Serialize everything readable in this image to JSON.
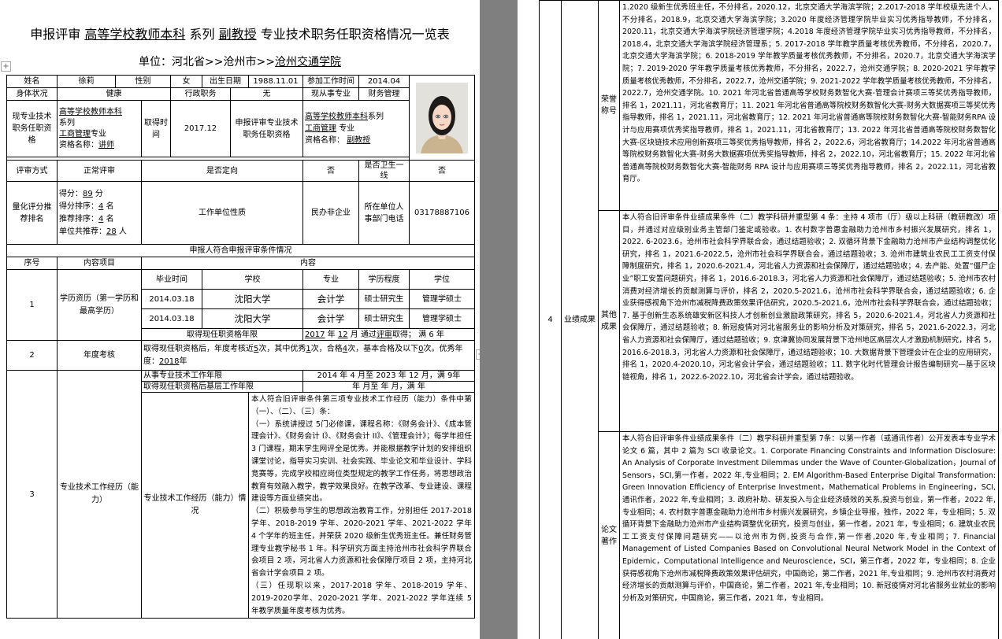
{
  "title": {
    "prefix": "申报评审",
    "school_type": "高等学校教师本科",
    "series_label": "系列",
    "rank": "副教授",
    "suffix": "专业技术职务任职资格情况一览表"
  },
  "unit": {
    "label": "单位：河北省>>沧州市>>",
    "name": "沧州交通学院"
  },
  "personal": {
    "name_label": "姓名",
    "name": "徐莉",
    "gender_label": "性别",
    "gender": "女",
    "birth_label": "出生日期",
    "birth": "1988.11.01",
    "work_start_label": "参加工作时间",
    "work_start": "2014.04",
    "health_label": "身体状况",
    "health": "健康",
    "admin_label": "行政职务",
    "admin": "无",
    "major_now_label": "现从事专业",
    "major_now": "财务管理"
  },
  "qualification": {
    "current_label": "现专业技术职务任职资格",
    "current_series": "高等学校教师本科",
    "series_word": "系列",
    "current_major": "工商管理",
    "major_word": "专业",
    "cert_label": "资格名称：",
    "current_name": "讲师",
    "obtain_label": "取得时间",
    "obtain_time": "2017.12",
    "apply_label": "申报评审专业技术职务任职资格",
    "apply_series": "高等学校教师本科",
    "apply_major": "工商管理",
    "apply_name": "副教授"
  },
  "review": {
    "method_label": "评审方式",
    "method": "正常评审",
    "directional_label": "是否定向",
    "directional": "否",
    "frontline_label": "是否卫生一线",
    "frontline": "否"
  },
  "score": {
    "label": "量化评分推荐排名",
    "score_prefix": "得分：",
    "score": "89",
    "score_unit": "分",
    "rank_prefix": "得分排序：",
    "rank": "4",
    "rank_unit": "名",
    "recommend_prefix": "推荐排序：",
    "recommend": "4",
    "recommend_unit": "名",
    "count_prefix": "单位共推荐：",
    "count": "28",
    "count_unit": "人",
    "unit_nature_label": "工作单位性质",
    "unit_nature": "民办非企业",
    "phone_label": "所在单位人事部门电话",
    "phone": "03178887106"
  },
  "conditions_heading": "申报人符合申报评审条件情况",
  "cond_headers": {
    "no": "序号",
    "item": "内容项目",
    "content": "内容"
  },
  "education": {
    "no": "1",
    "label": "学历资历（第一学历和最高学历）",
    "headers": [
      "毕业时间",
      "学校",
      "专业",
      "学历程度",
      "学位"
    ],
    "rows": [
      [
        "2014.03.18",
        "沈阳大学",
        "会计学",
        "硕士研究生",
        "管理学硕士"
      ],
      [
        "2014.03.18",
        "沈阳大学",
        "会计学",
        "硕士研究生",
        "管理学硕士"
      ]
    ],
    "years_label": "取得现任职资格年限",
    "years_year": "2017",
    "years_year_unit": "年",
    "years_month": "12",
    "years_month_unit": "月",
    "years_via": "通过",
    "years_method": "评审",
    "years_get": "取得；",
    "years_full_prefix": "满",
    "years_full": "6",
    "years_full_unit": "年"
  },
  "assessment": {
    "no": "2",
    "label": "年度考核",
    "p1": "取得现任职资格后，年度考核近",
    "n1": "5",
    "p2": "次，其中优秀",
    "n2": "1",
    "p3": "次，合格",
    "n3": "4",
    "p4": "次，基本合格及以下",
    "n4": "0",
    "p5": "次。优秀年度：",
    "excellent_year": "2018",
    "p6": "年"
  },
  "experience": {
    "no": "3",
    "label": "专业技术工作经历（能力）",
    "years_label": "从事专业技术工作年限",
    "years_value": "2014 年 4 月至 2023 年 12 月，满 9年",
    "after_label": "取得现任职资格后基层工作年限",
    "after_value": "年  月至  年  月，满  年",
    "sub_label": "专业技术工作经历（能力）情况",
    "text": [
      "本人符合旧评审条件第三项专业技术工作经历（能力）条件中第（一）、（二）、（三）条：",
      "（一）系统讲授过 5门必修课，课程名称：《财务会计》、《成本管理会计》、《财务会计 I》、《财务会计 II》、《管理会计》；每学年担任 3 门课程，期末学生网评全是优秀。并能根据教学计划的安排组织课堂讨论，指导实习实训、社会实践、毕业论文和毕业设计、学科竞赛等，完成学校相应岗位类型规定的教学工作任务，将思想政治教育有效融入教学，教学效果良好。在教学改革、专业建设、课程建设等方面业绩突出。",
      "（二）积极参与学生的思想政治教育工作，分别担任 2017-2018学年、2018-2019 学年、2020-2021 学年、2021-2022 学年 4 个学年的班主任，并荣获 2020 级新生优秀班主任。兼任财务管理专业教学秘书 1 年。科学研究方面主持沧州市社会科学界联合会项目 2 项，河北省人力资源和社会保障厅项目 2 项，主持河北省会计学会项目 2 项。",
      "（三）任现职以来，2017-2018 学年、2018-2019 学年、2019-2020学年、2020-2021 学年、2021-2022 学年连续 5 年教学质量年度考核为优秀。"
    ]
  },
  "achievement": {
    "no": "4",
    "label": "业绩成果",
    "honors_label": "荣誉称号",
    "honors_text": "1.2020 级新生优秀班主任，不分排名，2020.12，北京交通大学海滨学院；2.2017-2018 学年校级先进个人，不分排名，2018.9，北京交通大学海滨学院；3.2020 年度经济管理学院毕业实习优秀指导教师，不分排名，2020.11，北京交通大学海滨学院经济管理学院；4.2018 年度经济管理学院毕业实习优秀指导教师，不分排名，2018.4，北京交通大学海滨学院经济管理系；5. 2017-2018 学年教学质量考核优秀教师，不分排名，2020.7，北京交通大学海滨学院；6. 2018-2019 学年教学质量考核优秀教师，不分排名，2020.7，北京交通大学海滨学院；7. 2019-2020 学年教学质量考核优秀教师，不分排名，2022.7，沧州交通学院；8. 2020-2021 学年教学质量考核优秀教师，不分排名，2022.7，沧州交通学院；9. 2021-2022 学年教学质量考核优秀教师，不分排名，2022.7，沧州交通学院。10. 2021 年河北省普通高等学校财务数智化大赛-管理会计赛项三等奖优秀指导教师，排名 1，2021.11，河北省教育厅；11. 2021 年河北省普通高等院校财务数智化大赛-财务大数据赛项三等奖优秀指导教师，排名 1，2021.11，河北省教育厅；12. 2021 年河北省普通高等院校财务数智化大赛-智能财务RPA 设计与应用赛项优秀奖指导教师，排名 1，2021.11，河北省教育厅；13. 2022 年河北省普通高等院校财务数智化大赛-区块链技术应用创新赛项三等奖优秀指导教师，排名 2，2022.6，河北省教育厅；14.2022 年河北省普通高等院校财务数智化大赛-财务大数据赛项优秀奖指导教师，排名 2，2022.10，河北省教育厅；15. 2022 年河北省普通高等院校财务数智化大赛-智能财务 RPA 设计与应用赛项三等奖优秀指导教师，排名 2，2022.11，河北省教育厅。",
    "other_label": "其他成果",
    "other_text": "本人符合旧评审条件业绩成果条件（二）教学科研并重型第 4 条：主持 4 项市（厅）级以上科研（教研教改）项目，并通过对应级别业务主管部门鉴定或验收。1. 农村数字普惠金融助力沧州市乡村振兴发展研究，排名 1，2022. 6-2023.6，沧州市社会科学界联合会，通过结题验收；2. 双循环背景下金融助力沧州市产业结构调整优化研究，排名 1，2021.6-2022.5，沧州市社会科学界联合会，通过结题验收；3. 沧州市建筑业农民工工资支付保障制度研究，排名 1，2020.6-2021.4，河北省人力资源和社会保障厅，通过结题验收；4. 去产能、处置“僵尸企业”职工安置问题研究，排名 1，2016.6-2018.3，河北省人力资源和社会保障厅，通过结题验收；5. 沧州市农村消费对经济增长的贡献测算与评价，排名 2，2020.5-2021.6，沧州市社会科学界联合会，通过结题验收；6. 企业获得感视角下沧州市减税降费政策效果评估研究，2020.5-2021.6，沧州市社会科学界联合会，通过结题验收；7. 基于创新生态系统雄安新区科技人才创新创业激励政策研究，排名 5，2020.6-2021.4，河北省人力资源和社会保障厅，通过结题验收；8. 新冠疫情对河北省服务业的影响分析及对策研究，排名 5，2021.6-2022.3，河北省人力资源和社会保障厅，通过结题验收；9. 京津冀协同发展背景下沧州地区高层次人才激励机制研究，排名 5，2016.6-2018.3，河北省人力资源和社会保障厅，通过结题验收；10. 大数据背景下管理会计在企业的应用研究，排名 1，2020.4-2020.10，河北省会计学会，通过结题验收；11. 数字化时代管理会计报告编制研究—基于区块链视角，排名 1，2022.6-2022.10，河北省会计学会，通过结题验收。",
    "papers_label": "论文著作",
    "papers_text": "本人符合旧评审条件业绩成果条件（二）教学科研并重型第 7条：以第一作者（或通讯作者）公开发表本专业学术论文 6 篇，其中 2 篇为 SCI 收录论文。1. Corporate Financing Constraints and Information Disclosure: An Analysis of Corporate Investment Dilemmas under the Wave of Counter-Globalization，Journal of Sensors，SCI,第一作者，2022 年,专业相同；2. EM Algorithm-Based Enterprise Digital Transformation: Green Innovation Efficiency of Enterprise Investment，Mathematical Problems in Engineering，SCI,通讯作者，2022 年,专业相同；3. 政府补助、研发投入与企业经济绩效的关系,投资与创业，第一作者，2022 年,专业相同；4. 农村数字普惠金融助力沧州市乡村振兴发展研究，乡镇企业导报，独作，2022 年，专业相同；5. 双循环背景下金融助力沧州市产业结构调整优化研究，投资与创业，第一作者，2021 年，专业相同；6. 建筑业农民工工资支付保障问题研究——以沧州市为例,投资与合作,第一作者,2020 年,专业相同；7. Financial Management of Listed Companies Based on Convolutional Neural Network Model in the Context of Epidemic，Computational Intelligence and Neuroscience，SCI，第三作者，2022 年，专业相同；8. 企业获得感视角下沧州市减税降费政策效果评估研究，中国商论，第二作者，2021 年,专业相同；9. 沧州市农村消费对经济增长的贡献测算与评价，中国商论，第二作者，2021 年,专业相同；10. 新冠疫情对河北省服务业就业的影响分析及对策研究，中国商论，第三作者，2021 年，专业相同。"
  }
}
